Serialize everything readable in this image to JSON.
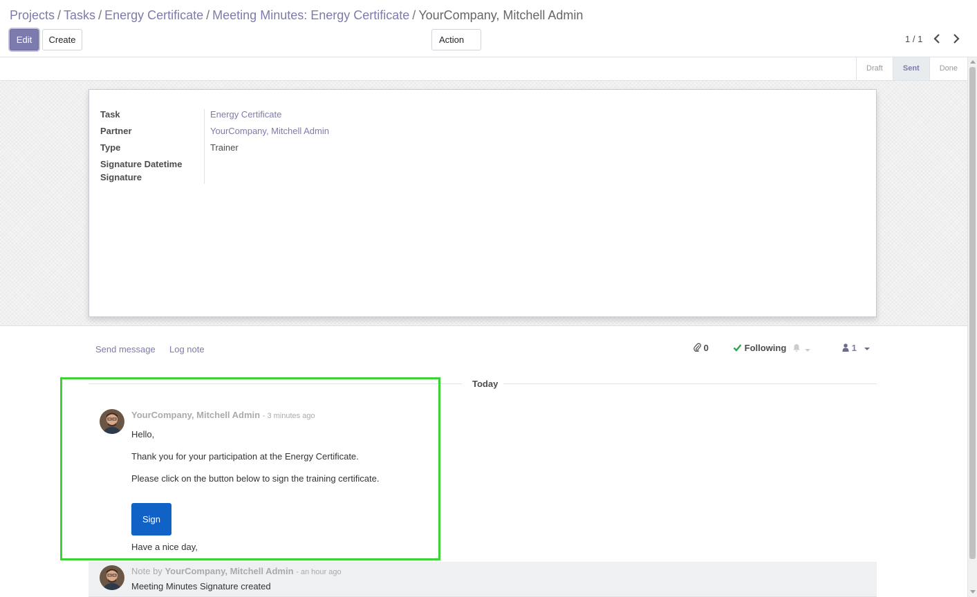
{
  "breadcrumb": {
    "items": [
      "Projects",
      "Tasks",
      "Energy Certificate",
      "Meeting Minutes: Energy Certificate"
    ],
    "current": "YourCompany, Mitchell Admin",
    "separator": "/"
  },
  "toolbar": {
    "edit_label": "Edit",
    "create_label": "Create",
    "action_label": "Action",
    "pager_text": "1 / 1"
  },
  "statusbar": {
    "stages": [
      "Draft",
      "Sent",
      "Done"
    ],
    "current": "Sent"
  },
  "form": {
    "task_label": "Task",
    "task_value": "Energy Certificate",
    "partner_label": "Partner",
    "partner_value": "YourCompany, Mitchell Admin",
    "type_label": "Type",
    "type_value": "Trainer",
    "signature_datetime_label": "Signature Datetime",
    "signature_label": "Signature"
  },
  "chatter": {
    "send_message_label": "Send message",
    "log_note_label": "Log note",
    "attachment_count": "0",
    "following_label": "Following",
    "follower_count": "1",
    "today_label": "Today",
    "message": {
      "author": "YourCompany, Mitchell Admin",
      "time": "- 3 minutes ago",
      "lines": [
        "Hello,",
        "Thank you for your participation at the Energy Certificate.",
        "Please click on the button below to sign the training certificate."
      ],
      "sign_button": "Sign",
      "closing": "Have a nice day,"
    },
    "note": {
      "prefix": "Note by",
      "author": "YourCompany, Mitchell Admin",
      "time": "- an hour ago",
      "body": "Meeting Minutes Signature created"
    }
  },
  "colors": {
    "accent": "#7c7bad",
    "sign_button": "#1062c7",
    "highlight_border": "#3cd336",
    "following_check": "#28a745"
  }
}
